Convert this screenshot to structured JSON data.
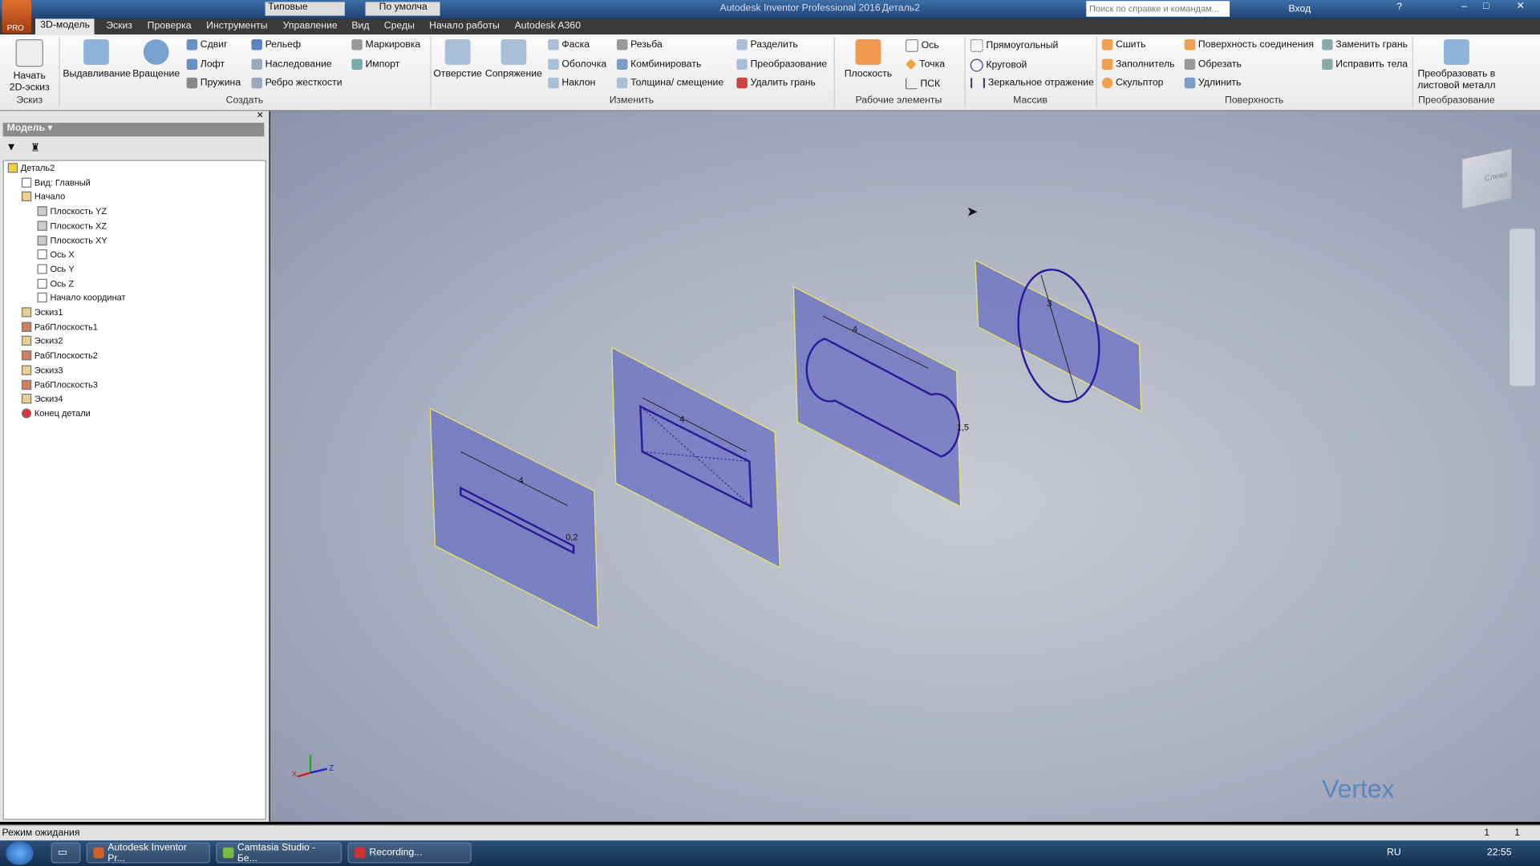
{
  "titlebar": {
    "title": "Autodesk Inventor Professional 2016",
    "document": "Деталь2",
    "search_placeholder": "Поиск по справке и командам...",
    "signin": "Вход",
    "style_combo": "Типовые",
    "appearance_combo": "По умолча",
    "app_badge": "PRO"
  },
  "tabs": [
    "3D-модель",
    "Эскиз",
    "Проверка",
    "Инструменты",
    "Управление",
    "Вид",
    "Среды",
    "Начало работы",
    "Autodesk A360"
  ],
  "ribbon": {
    "sketch": {
      "start": "Начать 2D-эскиз",
      "group": "Эскиз"
    },
    "create": {
      "extrude": "Выдавливание",
      "revolve": "Вращение",
      "sweep": "Сдвиг",
      "loft": "Лофт",
      "coil": "Пружина",
      "emboss": "Рельеф",
      "derive": "Наследование",
      "rib": "Ребро жесткости",
      "mark": "Маркировка",
      "import": "Импорт",
      "group": "Создать"
    },
    "modify": {
      "hole": "Отверстие",
      "fillet": "Сопряжение",
      "chamfer": "Фаска",
      "shell": "Оболочка",
      "draft": "Наклон",
      "thread": "Резьба",
      "combine": "Комбинировать",
      "thicken": "Толщина/ смещение",
      "split": "Разделить",
      "direct": "Преобразование",
      "delete_face": "Удалить грань",
      "group": "Изменить"
    },
    "work": {
      "plane": "Плоскость",
      "axis": "Ось",
      "point": "Точка",
      "ucs": "ПСК",
      "group": "Рабочие элементы"
    },
    "pattern": {
      "rect": "Прямоугольный",
      "circ": "Круговой",
      "mirror": "Зеркальное отражение",
      "group": "Массив"
    },
    "surface": {
      "stitch": "Сшить",
      "patch": "Заполнитель",
      "sculpt": "Скульптор",
      "ruled": "Поверхность соединения",
      "trim": "Обрезать",
      "extend": "Удлинить",
      "replace": "Заменить грань",
      "repair": "Исправить тела",
      "group": "Поверхность"
    },
    "convert": {
      "sheet": "Преобразовать в листовой металл",
      "group": "Преобразование"
    }
  },
  "panel": {
    "title": "Модель",
    "tree": [
      {
        "label": "Деталь2",
        "level": 0,
        "icon": "part-icon"
      },
      {
        "label": "Вид: Главный",
        "level": 1,
        "icon": "view-icon"
      },
      {
        "label": "Начало",
        "level": 1,
        "icon": "folder-icon"
      },
      {
        "label": "Плоскость YZ",
        "level": 2,
        "icon": "plane-icon"
      },
      {
        "label": "Плоскость XZ",
        "level": 2,
        "icon": "plane-icon"
      },
      {
        "label": "Плоскость XY",
        "level": 2,
        "icon": "plane-icon"
      },
      {
        "label": "Ось X",
        "level": 2,
        "icon": "axis-icon"
      },
      {
        "label": "Ось Y",
        "level": 2,
        "icon": "axis-icon"
      },
      {
        "label": "Ось Z",
        "level": 2,
        "icon": "axis-icon"
      },
      {
        "label": "Начало координат",
        "level": 2,
        "icon": "origin-icon"
      },
      {
        "label": "Эскиз1",
        "level": 1,
        "icon": "sketch-icon"
      },
      {
        "label": "РабПлоскость1",
        "level": 1,
        "icon": "workplane-icon"
      },
      {
        "label": "Эскиз2",
        "level": 1,
        "icon": "sketch-icon"
      },
      {
        "label": "РабПлоскость2",
        "level": 1,
        "icon": "workplane-icon"
      },
      {
        "label": "Эскиз3",
        "level": 1,
        "icon": "sketch-icon"
      },
      {
        "label": "РабПлоскость3",
        "level": 1,
        "icon": "workplane-icon"
      },
      {
        "label": "Эскиз4",
        "level": 1,
        "icon": "sketch-icon"
      },
      {
        "label": "Конец детали",
        "level": 1,
        "icon": "end-of-part-icon"
      }
    ]
  },
  "viewport": {
    "dims": [
      "4",
      "0,2",
      "4",
      "4",
      "1,5",
      "3"
    ],
    "viewcube_label": "Слева",
    "watermark": "Vertex",
    "colors": {
      "plane": "#6f74c2",
      "sketch": "#2a1a9a",
      "edge": "#e8e860"
    }
  },
  "status": {
    "text": "Режим ожидания",
    "count1": "1",
    "count2": "1"
  },
  "taskbar": {
    "items": [
      "Autodesk Inventor Pr...",
      "Camtasia Studio - Бе...",
      "Recording..."
    ],
    "lang": "RU",
    "time": "22:55"
  }
}
